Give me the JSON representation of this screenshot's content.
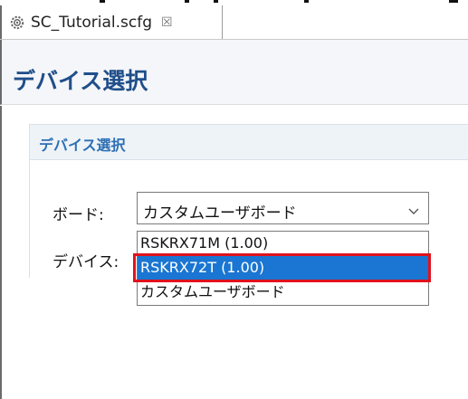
{
  "tab": {
    "label": "SC_Tutorial.scfg",
    "close": "☒",
    "icon": "gear-icon"
  },
  "page": {
    "title": "デバイス選択"
  },
  "section": {
    "title": "デバイス選択"
  },
  "form": {
    "board_label": "ボード:",
    "device_label": "デバイス:",
    "board_value": "カスタムユーザボード"
  },
  "dropdown": {
    "options": [
      "RSKRX71M (1.00)",
      "RSKRX72T (1.00)",
      "カスタムユーザボード"
    ],
    "highlighted_index": 1
  },
  "colors": {
    "title": "#1f4e8a",
    "section_title": "#2d6fb3",
    "selected_bg": "#1a76d2",
    "annotation": "#e0121c"
  }
}
